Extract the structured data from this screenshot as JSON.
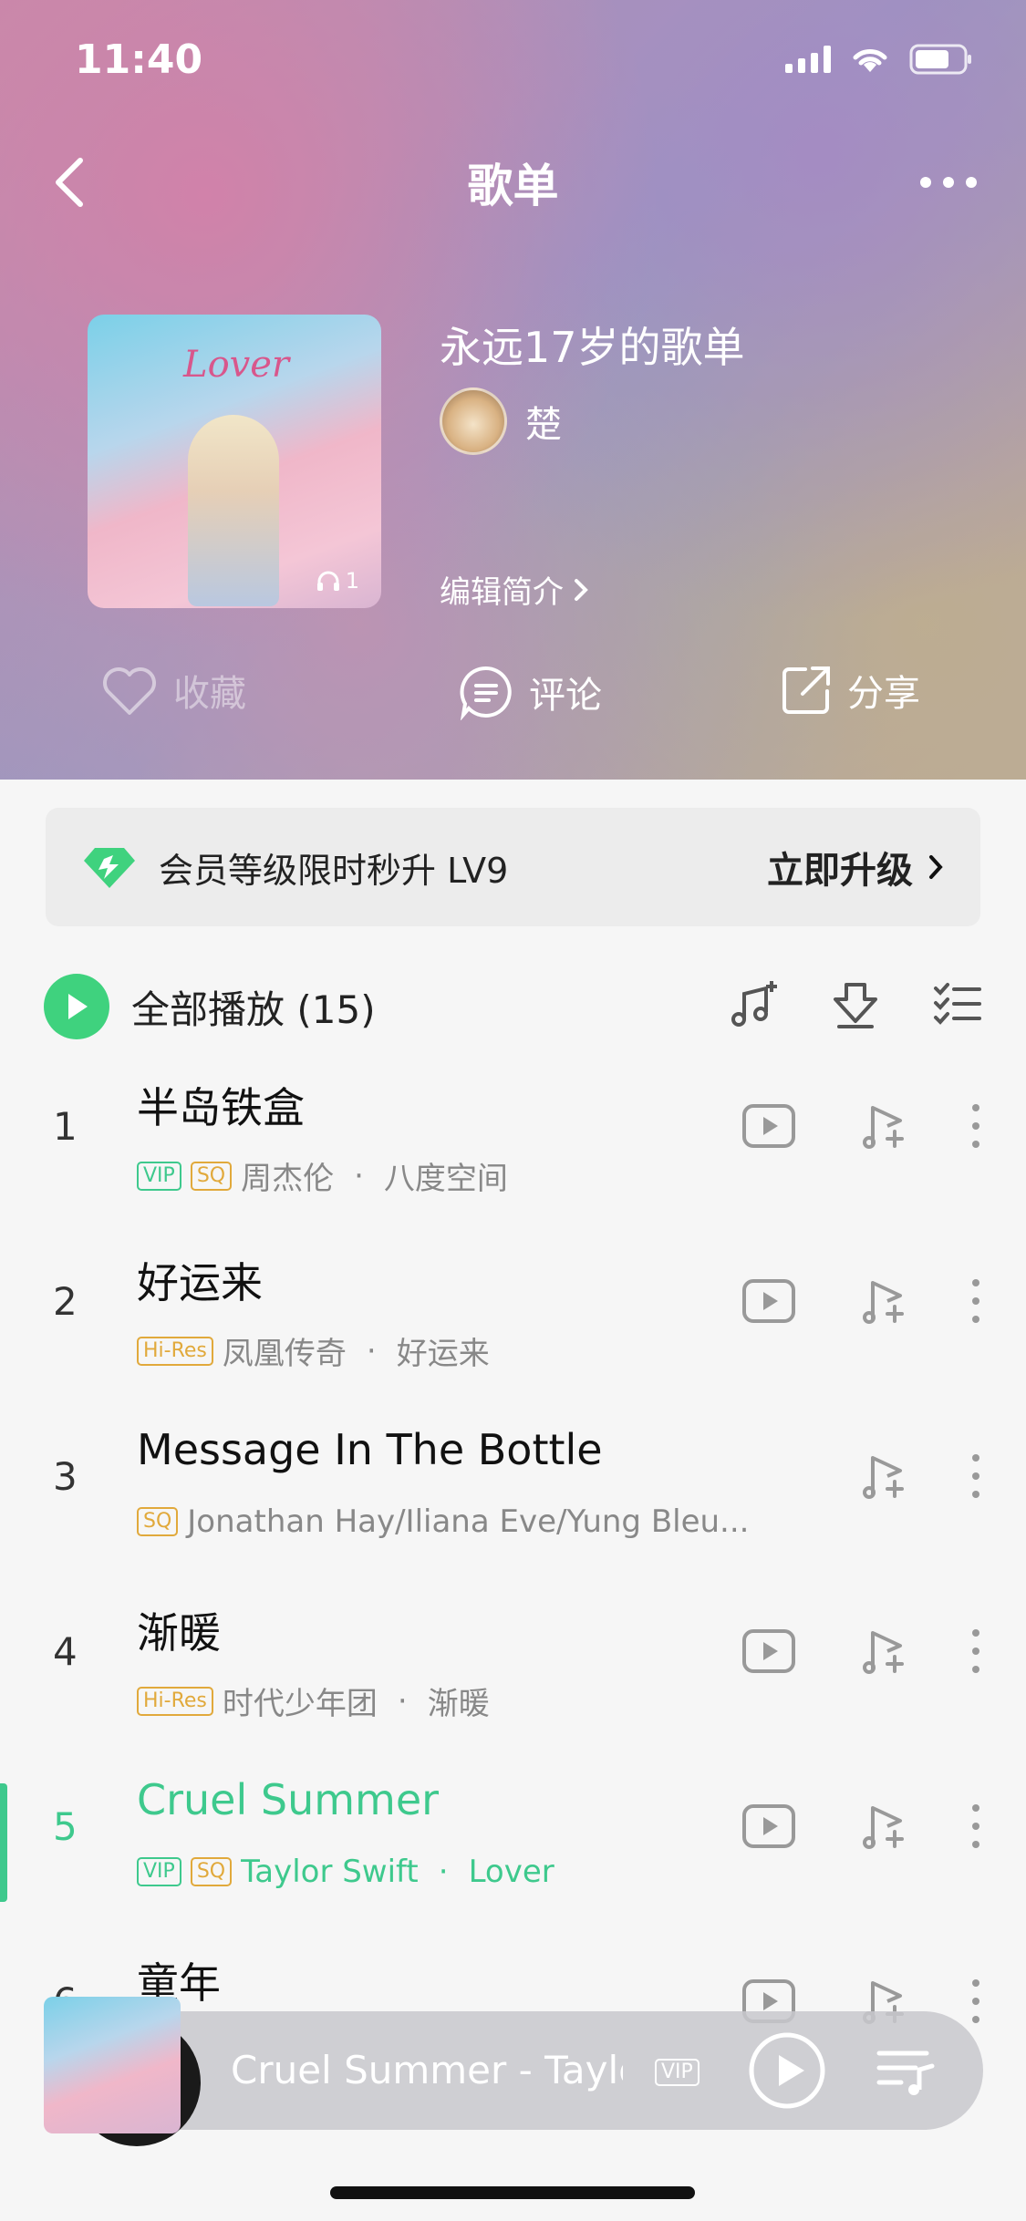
{
  "status_bar": {
    "time": "11:40"
  },
  "nav": {
    "title": "歌单"
  },
  "playlist": {
    "title": "永远17岁的歌单",
    "owner": "楚",
    "cover_text": "Lover",
    "play_count": "1",
    "edit_label": "编辑简介"
  },
  "actions": {
    "favorite": "收藏",
    "comment": "评论",
    "share": "分享"
  },
  "promo": {
    "text": "会员等级限时秒升 LV9",
    "cta": "立即升级"
  },
  "play_all": {
    "label": "全部播放",
    "count": "(15)"
  },
  "songs": [
    {
      "index": "1",
      "title": "半岛铁盒",
      "tags": [
        "VIP",
        "SQ"
      ],
      "artist": "周杰伦",
      "album": "八度空间",
      "has_mv": true
    },
    {
      "index": "2",
      "title": "好运来",
      "tags": [
        "Hi-Res"
      ],
      "artist": "凤凰传奇",
      "album": "好运来",
      "has_mv": true
    },
    {
      "index": "3",
      "title": "Message In The Bottle",
      "tags": [
        "SQ"
      ],
      "artist": "Jonathan Hay/Iliana Eve/Yung Bleu...",
      "album": "",
      "has_mv": false
    },
    {
      "index": "4",
      "title": "渐暖",
      "tags": [
        "Hi-Res"
      ],
      "artist": "时代少年团",
      "album": "渐暖",
      "has_mv": true
    },
    {
      "index": "5",
      "title": "Cruel Summer",
      "tags": [
        "VIP",
        "SQ"
      ],
      "artist": "Taylor Swift",
      "album": "Lover",
      "has_mv": true,
      "playing": true
    },
    {
      "index": "6",
      "title": "童年",
      "tags": [],
      "artist": "",
      "album": "",
      "has_mv": true
    }
  ],
  "mini_player": {
    "title": "Cruel Summer - Taylor Swift",
    "badge": "VIP"
  },
  "colors": {
    "accent": "#3ec98d",
    "play_all": "#3fd27e",
    "tag_gold": "#e1a93b"
  }
}
